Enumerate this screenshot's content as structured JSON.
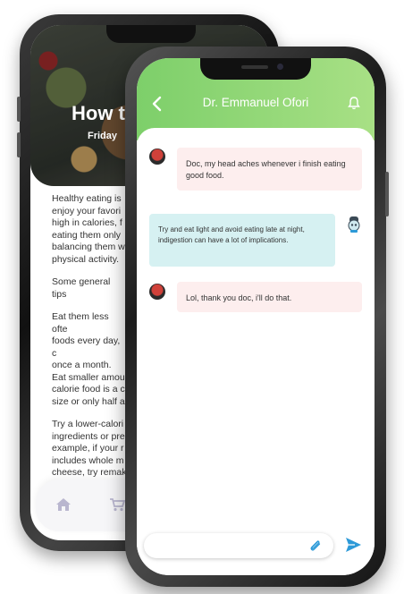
{
  "back_screen": {
    "article_title": "How to",
    "article_date": "Friday",
    "paragraphs": [
      "Healthy eating is\nenjoy your favori\nhigh in calories, f\neating them only\nbalancing them w\nphysical activity.",
      "Some general tips",
      "Eat them less ofte\nfoods every day, c\nonce a month.\nEat smaller amou\ncalorie food is a c\nsize or only half a",
      "Try a lower-calori\ningredients or pre\nexample, if your r\nincludes whole m\ncheese, try remak\nbutter, low-fat ch\ntomatoes. Just re\nportion size."
    ],
    "nav_icons": [
      "home-icon",
      "cart-icon"
    ]
  },
  "chat": {
    "doctor_name": "Dr. Emmanuel Ofori",
    "back_icon": "chevron-left-icon",
    "bell_icon": "bell-icon",
    "messages": [
      {
        "sender": "patient",
        "text": "Doc, my head aches whenever i finish eating good food."
      },
      {
        "sender": "doctor",
        "text": "Try and eat light and avoid eating late at night, indigestion can have a lot of implications."
      },
      {
        "sender": "patient",
        "text": "Lol, thank you doc, i'll do that."
      }
    ],
    "input": {
      "placeholder": "",
      "value": ""
    },
    "attach_icon": "paperclip-icon",
    "send_icon": "send-icon"
  },
  "colors": {
    "header_start": "#7dcf6a",
    "header_end": "#a8e085",
    "patient_bubble": "#fdeeee",
    "doctor_bubble": "#d6f1f2",
    "send_button": "#2d9ad8"
  }
}
